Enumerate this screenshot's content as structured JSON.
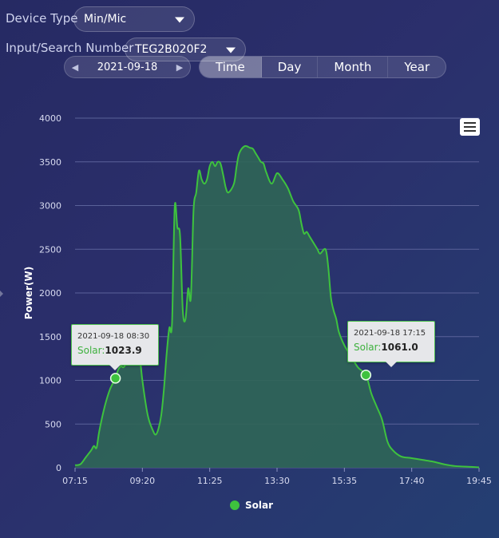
{
  "controls": {
    "device_type_label": "Device Type",
    "device_type_value": "Min/Mic",
    "search_label": "Input/Search Number",
    "search_value": "TEG2B020F2",
    "date": "2021-09-18",
    "tabs": [
      "Time",
      "Day",
      "Month",
      "Year"
    ],
    "active_tab": "Time"
  },
  "colors": {
    "series": "#3ec23e",
    "area": "#2f6656",
    "grid": "#5a6299",
    "background": "#2a2e6a"
  },
  "chart_data": {
    "type": "area",
    "ylabel": "Power(W)",
    "xlabel": "",
    "ylim": [
      0,
      4000
    ],
    "yticks": [
      0,
      500,
      1000,
      1500,
      2000,
      2500,
      3000,
      3500,
      4000
    ],
    "xticks": [
      "07:15",
      "09:20",
      "11:25",
      "13:30",
      "15:35",
      "17:40",
      "19:45"
    ],
    "x_range_minutes": [
      435,
      1185
    ],
    "legend": "bottom-center",
    "grid": true,
    "series": [
      {
        "name": "Solar",
        "points": [
          [
            "07:15",
            30
          ],
          [
            "07:25",
            40
          ],
          [
            "07:35",
            120
          ],
          [
            "07:45",
            200
          ],
          [
            "07:50",
            250
          ],
          [
            "07:55",
            230
          ],
          [
            "08:00",
            420
          ],
          [
            "08:10",
            700
          ],
          [
            "08:20",
            900
          ],
          [
            "08:30",
            1023.9
          ],
          [
            "08:35",
            1120
          ],
          [
            "08:40",
            1160
          ],
          [
            "08:45",
            1150
          ],
          [
            "08:50",
            1200
          ],
          [
            "08:55",
            1300
          ],
          [
            "09:00",
            1500
          ],
          [
            "09:05",
            1600
          ],
          [
            "09:10",
            1550
          ],
          [
            "09:15",
            1300
          ],
          [
            "09:20",
            1000
          ],
          [
            "09:30",
            600
          ],
          [
            "09:40",
            420
          ],
          [
            "09:45",
            380
          ],
          [
            "09:50",
            450
          ],
          [
            "09:55",
            600
          ],
          [
            "10:00",
            900
          ],
          [
            "10:05",
            1300
          ],
          [
            "10:10",
            1600
          ],
          [
            "10:15",
            1650
          ],
          [
            "10:20",
            2980
          ],
          [
            "10:25",
            2750
          ],
          [
            "10:30",
            2650
          ],
          [
            "10:35",
            1800
          ],
          [
            "10:40",
            1700
          ],
          [
            "10:45",
            2050
          ],
          [
            "10:50",
            1950
          ],
          [
            "10:55",
            2950
          ],
          [
            "11:00",
            3150
          ],
          [
            "11:05",
            3400
          ],
          [
            "11:10",
            3300
          ],
          [
            "11:15",
            3250
          ],
          [
            "11:20",
            3300
          ],
          [
            "11:25",
            3450
          ],
          [
            "11:30",
            3500
          ],
          [
            "11:35",
            3450
          ],
          [
            "11:40",
            3500
          ],
          [
            "11:45",
            3480
          ],
          [
            "11:50",
            3350
          ],
          [
            "11:55",
            3200
          ],
          [
            "12:00",
            3150
          ],
          [
            "12:10",
            3250
          ],
          [
            "12:15",
            3450
          ],
          [
            "12:20",
            3600
          ],
          [
            "12:30",
            3680
          ],
          [
            "12:40",
            3660
          ],
          [
            "12:45",
            3650
          ],
          [
            "12:50",
            3600
          ],
          [
            "12:55",
            3550
          ],
          [
            "13:00",
            3500
          ],
          [
            "13:05",
            3480
          ],
          [
            "13:10",
            3380
          ],
          [
            "13:20",
            3250
          ],
          [
            "13:30",
            3370
          ],
          [
            "13:40",
            3300
          ],
          [
            "13:50",
            3200
          ],
          [
            "14:00",
            3050
          ],
          [
            "14:10",
            2950
          ],
          [
            "14:15",
            2800
          ],
          [
            "14:20",
            2680
          ],
          [
            "14:25",
            2700
          ],
          [
            "14:30",
            2650
          ],
          [
            "14:35",
            2600
          ],
          [
            "14:40",
            2550
          ],
          [
            "14:45",
            2500
          ],
          [
            "14:50",
            2450
          ],
          [
            "15:00",
            2500
          ],
          [
            "15:05",
            2300
          ],
          [
            "15:10",
            1950
          ],
          [
            "15:15",
            1800
          ],
          [
            "15:20",
            1700
          ],
          [
            "15:25",
            1550
          ],
          [
            "15:35",
            1400
          ],
          [
            "15:45",
            1300
          ],
          [
            "16:00",
            1150
          ],
          [
            "16:15",
            1061.0
          ],
          [
            "16:25",
            850
          ],
          [
            "16:35",
            700
          ],
          [
            "16:45",
            550
          ],
          [
            "16:55",
            300
          ],
          [
            "17:05",
            200
          ],
          [
            "17:20",
            130
          ],
          [
            "17:40",
            110
          ],
          [
            "18:00",
            90
          ],
          [
            "18:20",
            70
          ],
          [
            "18:40",
            40
          ],
          [
            "19:00",
            20
          ],
          [
            "19:30",
            10
          ],
          [
            "19:45",
            5
          ]
        ]
      }
    ],
    "tooltips": [
      {
        "time": "2021-09-18 08:30",
        "series_label": "Solar:",
        "value": "1023.9",
        "x": "08:30",
        "y": 1023.9
      },
      {
        "time": "2021-09-18 17:15",
        "series_label": "Solar:",
        "value": "1061.0",
        "x": "16:15",
        "y": 1061.0
      }
    ]
  }
}
